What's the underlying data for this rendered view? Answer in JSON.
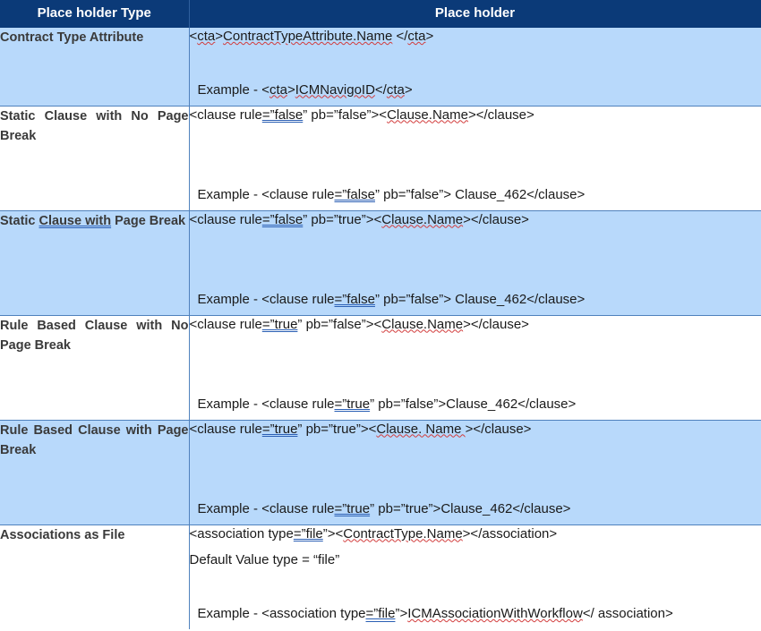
{
  "header": {
    "col1": "Place holder Type",
    "col2": "Place holder"
  },
  "rows": [
    {
      "type": "Contract Type Attribute",
      "syntax": [
        "<",
        "cta",
        ">",
        "ContractTypeAttribute.Name",
        " </",
        "cta",
        ">"
      ],
      "example": [
        "Example - <",
        "cta",
        ">",
        "ICMNavigoID",
        "</",
        "cta",
        ">"
      ]
    },
    {
      "type": "Static Clause with No Page Break",
      "syntax": [
        "<clause rule",
        "=”false",
        "” pb=”false”><",
        "Clause.Name",
        "></clause>"
      ],
      "example": [
        "Example - <clause rule",
        "=”false",
        "” pb=”false”> Clause_462</clause>"
      ]
    },
    {
      "type_parts": [
        "Static ",
        "Clause  with",
        " Page Break"
      ],
      "syntax": [
        "<clause rule",
        "=”false",
        "” pb=”true”><",
        "Clause.Name",
        "></clause>"
      ],
      "example": [
        "Example - <clause rule",
        "=”false",
        "” pb=”false”> Clause_462</clause>"
      ]
    },
    {
      "type": "Rule Based Clause with No Page Break",
      "syntax": [
        "<clause rule",
        "=”true",
        "” pb=”false”><",
        "Clause.Name",
        "></clause>"
      ],
      "example": [
        "Example - <clause rule",
        "=”true",
        "” pb=”false”>Clause_462</clause>"
      ]
    },
    {
      "type": "Rule Based Clause with Page Break",
      "syntax": [
        "<clause rule",
        "=”true",
        "” pb=”true”><",
        "Clause. Name ",
        "></clause>"
      ],
      "example": [
        "Example - <clause rule",
        "=”true",
        "” pb=”true”>Clause_462</clause>"
      ]
    },
    {
      "type": "Associations as File",
      "syntax": [
        "<association type",
        "=”file",
        "”><",
        "ContractType.Name",
        "></association>"
      ],
      "default": "Default Value type = “file”",
      "example": [
        "Example - <association type",
        "=”file",
        "”>",
        "ICMAssociationWithWorkflow",
        "</ association>"
      ]
    }
  ],
  "colors": {
    "header_bg": "#0b3a78",
    "alt_row_bg": "#b8d9fb",
    "border": "#4f81bd"
  }
}
